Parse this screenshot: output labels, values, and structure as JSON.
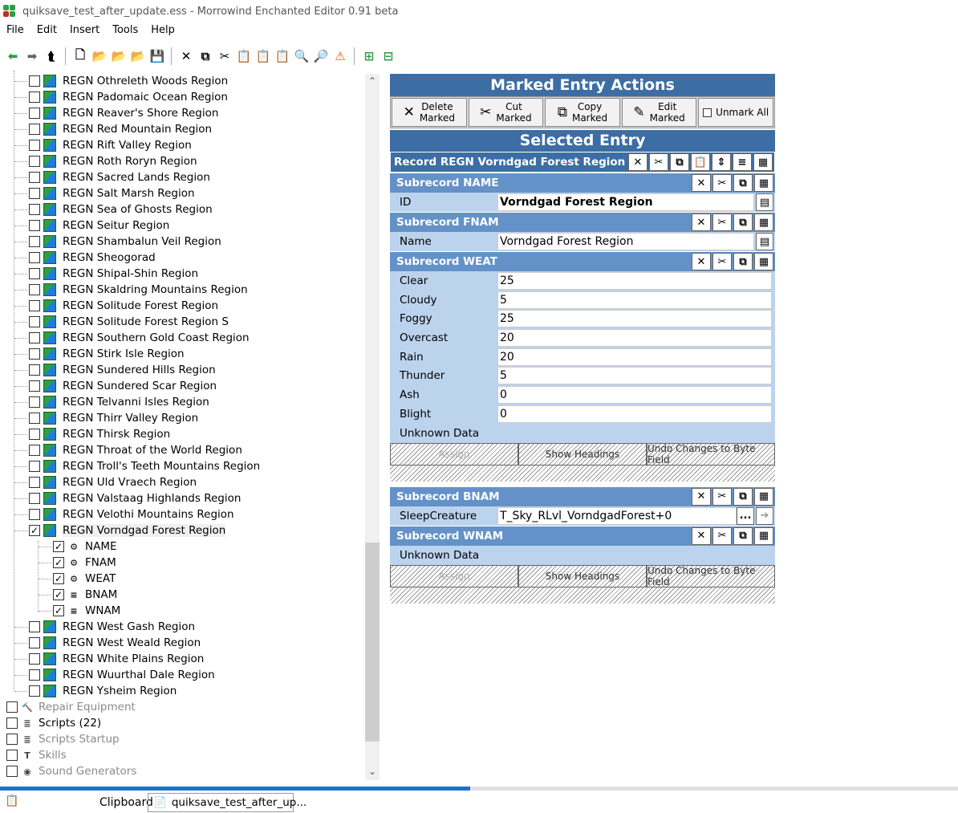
{
  "window": {
    "title": "quiksave_test_after_update.ess - Morrowind Enchanted Editor 0.91 beta"
  },
  "menu": [
    "File",
    "Edit",
    "Insert",
    "Tools",
    "Help"
  ],
  "tree": {
    "regions_before": [
      "REGN Othreleth Woods Region",
      "REGN Padomaic Ocean Region",
      "REGN Reaver's Shore Region",
      "REGN Red Mountain Region",
      "REGN Rift Valley Region",
      "REGN Roth Roryn Region",
      "REGN Sacred Lands Region",
      "REGN Salt Marsh Region",
      "REGN Sea of Ghosts Region",
      "REGN Seitur Region",
      "REGN Shambalun Veil Region",
      "REGN Sheogorad",
      "REGN Shipal-Shin Region",
      "REGN Skaldring Mountains Region",
      "REGN Solitude Forest Region",
      "REGN Solitude Forest Region S",
      "REGN Southern Gold Coast Region",
      "REGN Stirk Isle Region",
      "REGN Sundered Hills Region",
      "REGN Sundered Scar Region",
      "REGN Telvanni Isles Region",
      "REGN Thirr Valley Region",
      "REGN Thirsk Region",
      "REGN Throat of the World Region",
      "REGN Troll's Teeth Mountains Region",
      "REGN Uld Vraech Region",
      "REGN Valstaag Highlands Region",
      "REGN Velothi Mountains Region"
    ],
    "selected": "REGN Vorndgad Forest Region",
    "subrecords": [
      "NAME",
      "FNAM",
      "WEAT",
      "BNAM",
      "WNAM"
    ],
    "regions_after": [
      "REGN West Gash Region",
      "REGN West Weald Region",
      "REGN White Plains Region",
      "REGN Wuurthal Dale Region",
      "REGN Ysheim Region"
    ],
    "categories": [
      "Repair Equipment",
      "Scripts  (22)",
      "Scripts Startup",
      "Skills",
      "Sound Generators"
    ]
  },
  "marked": {
    "title": "Marked Entry Actions",
    "delete": [
      "Delete",
      "Marked"
    ],
    "cut": [
      "Cut",
      "Marked"
    ],
    "copy": [
      "Copy",
      "Marked"
    ],
    "edit": [
      "Edit",
      "Marked"
    ],
    "unmark": "Unmark All"
  },
  "selected_entry": {
    "title": "Selected Entry",
    "record": "Record REGN Vorndgad Forest Region",
    "sub_name": "Subrecord NAME",
    "id_label": "ID",
    "id_value": "Vorndgad Forest Region",
    "sub_fnam": "Subrecord FNAM",
    "name_label": "Name",
    "name_value": "Vorndgad Forest Region",
    "sub_weat": "Subrecord WEAT",
    "weather": [
      {
        "label": "Clear",
        "value": "25"
      },
      {
        "label": "Cloudy",
        "value": "5"
      },
      {
        "label": "Foggy",
        "value": "25"
      },
      {
        "label": "Overcast",
        "value": "20"
      },
      {
        "label": "Rain",
        "value": "20"
      },
      {
        "label": "Thunder",
        "value": "5"
      },
      {
        "label": "Ash",
        "value": "0"
      },
      {
        "label": "Blight",
        "value": "0"
      }
    ],
    "unknown": "Unknown Data",
    "btn_assign": "Assign",
    "btn_headings": "Show Headings",
    "btn_undo": "Undo Changes to Byte Field",
    "sub_bnam": "Subrecord BNAM",
    "sleep_label": "SleepCreature",
    "sleep_value": "T_Sky_RLvl_VorndgadForest+0",
    "ellipsis": "...",
    "sub_wnam": "Subrecord WNAM"
  },
  "status": {
    "clipboard": "Clipboard",
    "tab": "quiksave_test_after_up..."
  }
}
